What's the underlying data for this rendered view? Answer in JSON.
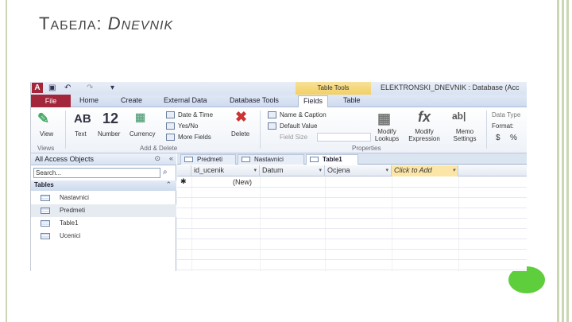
{
  "slide": {
    "title_cap1": "T",
    "title_rest1": "АБЕЛА",
    "title_colon": ": ",
    "title_cap2": "D",
    "title_rest2": "NEVNIK"
  },
  "window": {
    "app_icon": "A",
    "context_tab": "Table Tools",
    "title": "ELEKTRONSKI_DNEVNIK : Database (Acc"
  },
  "tabs": {
    "file": "File",
    "home": "Home",
    "create": "Create",
    "external": "External Data",
    "dbtools": "Database Tools",
    "fields": "Fields",
    "table": "Table"
  },
  "ribbon": {
    "view": "View",
    "views_group": "Views",
    "text_big": "AB",
    "text": "Text",
    "number_big": "12",
    "number": "Number",
    "currency": "Currency",
    "date_time": "Date & Time",
    "yes_no": "Yes/No",
    "more_fields": "More Fields",
    "delete": "Delete",
    "add_delete_group": "Add & Delete",
    "name_caption": "Name & Caption",
    "default_value": "Default Value",
    "field_size": "Field Size",
    "properties_group": "Properties",
    "modify_lookups": "Modify Lookups",
    "modify_expression": "Modify Expression",
    "memo_settings": "Memo Settings",
    "data_type": "Data Type",
    "format": "Format:",
    "dollar": "$",
    "percent": "%"
  },
  "nav": {
    "title": "All Access Objects",
    "search_placeholder": "Search...",
    "group": "Tables",
    "items": [
      "Nastavnici",
      "Predmeti",
      "Table1",
      "Ucenici"
    ]
  },
  "doc_tabs": [
    "Predmeti",
    "Nastavnici",
    "Table1"
  ],
  "grid": {
    "columns": [
      "id_ucenik",
      "Datum",
      "Ocjena",
      "Click to Add"
    ],
    "new_marker": "✱",
    "new_value": "(New)"
  }
}
